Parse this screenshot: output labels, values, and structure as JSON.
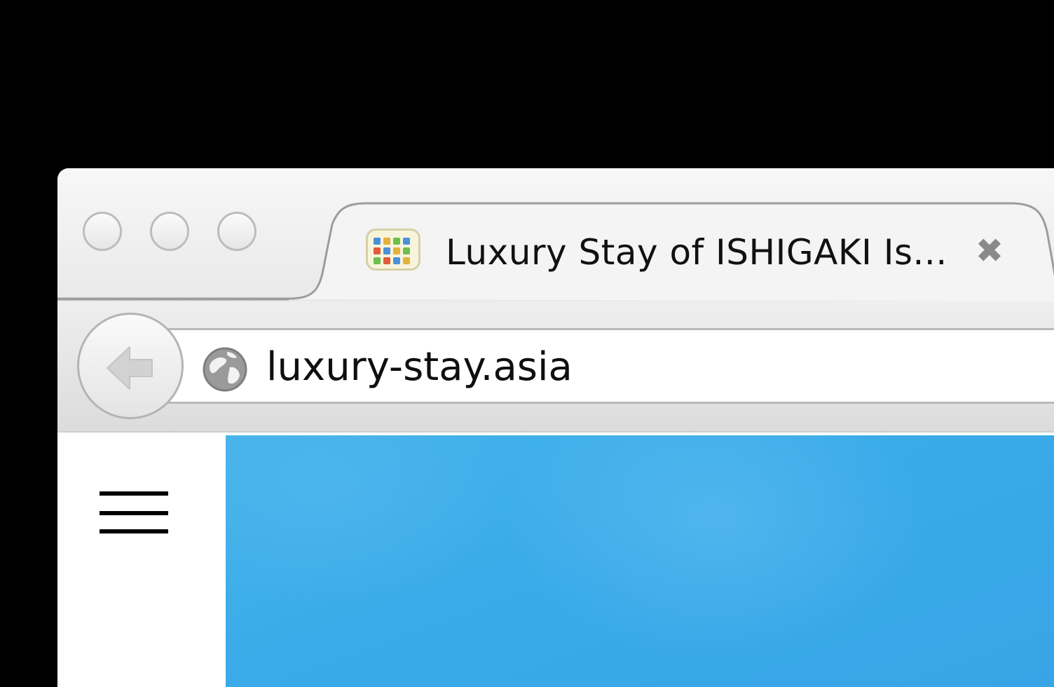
{
  "tab": {
    "title": "Luxury Stay of ISHIGAKI Is...",
    "close_glyph": "✖"
  },
  "address_bar": {
    "url": "luxury-stay.asia"
  },
  "icons": {
    "favicon": "site-favicon-icon",
    "back": "back-arrow-icon",
    "globe": "globe-icon",
    "menu": "hamburger-menu-icon"
  },
  "colors": {
    "hero_sky": "#3aabe9",
    "backdrop": "#000000"
  }
}
